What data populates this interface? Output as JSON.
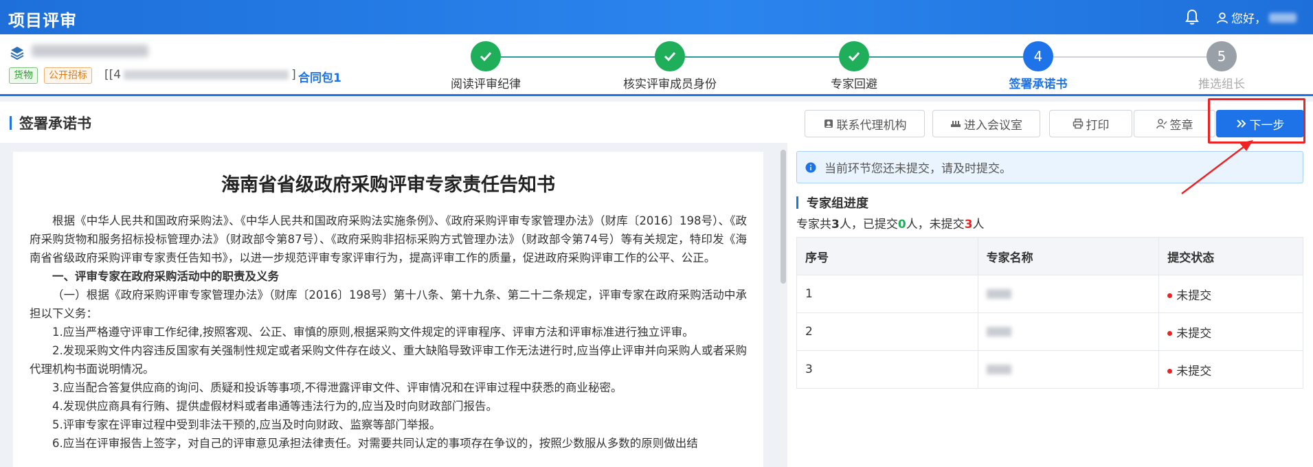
{
  "header": {
    "title": "项目评审",
    "greeting": "您好，"
  },
  "project": {
    "tags": [
      "货物",
      "公开招标"
    ],
    "code_prefix": "[[4",
    "code_suffix": "]",
    "package": "合同包1"
  },
  "steps": [
    {
      "label": "阅读评审纪律",
      "state": "done"
    },
    {
      "label": "核实评审成员身份",
      "state": "done"
    },
    {
      "label": "专家回避",
      "state": "done"
    },
    {
      "label": "签署承诺书",
      "state": "current",
      "number": "4"
    },
    {
      "label": "推选组长",
      "state": "todo",
      "number": "5"
    }
  ],
  "section": {
    "title": "签署承诺书",
    "buttons": {
      "contact": "联系代理机构",
      "meeting": "进入会议室",
      "print": "打印",
      "sign": "签章",
      "next": "下一步"
    }
  },
  "document": {
    "title": "海南省省级政府采购评审专家责任告知书",
    "paragraphs": [
      "根据《中华人民共和国政府采购法》、《中华人民共和国政府采购法实施条例》、《政府采购评审专家管理办法》（财库〔2016〕198号）、《政府采购货物和服务招标投标管理办法》（财政部令第87号）、《政府采购非招标采购方式管理办法》（财政部令第74号）等有关规定，特印发《海南省省级政府采购评审专家责任告知书》，以进一步规范评审专家评审行为，提高评审工作的质量，促进政府采购评审工作的公平、公正。",
      "一、评审专家在政府采购活动中的职责及义务",
      "（一）根据《政府采购评审专家管理办法》（财库〔2016〕198号）第十八条、第十九条、第二十二条规定，评审专家在政府采购活动中承担以下义务：",
      "1.应当严格遵守评审工作纪律,按照客观、公正、审慎的原则,根据采购文件规定的评审程序、评审方法和评审标准进行独立评审。",
      "2.发现采购文件内容违反国家有关强制性规定或者采购文件存在歧义、重大缺陷导致评审工作无法进行时,应当停止评审并向采购人或者采购代理机构书面说明情况。",
      "3.应当配合答复供应商的询问、质疑和投诉等事项,不得泄露评审文件、评审情况和在评审过程中获悉的商业秘密。",
      "4.发现供应商具有行贿、提供虚假材料或者串通等违法行为的,应当及时向财政部门报告。",
      "5.评审专家在评审过程中受到非法干预的,应当及时向财政、监察等部门举报。",
      "6.应当在评审报告上签字，对自己的评审意见承担法律责任。对需要共同认定的事项存在争议的，按照少数服从多数的原则做出结"
    ]
  },
  "notice": "当前环节您还未提交，请及时提交。",
  "progress": {
    "title": "专家组进度",
    "summary_prefix": "专家共",
    "total": "3",
    "summary_mid1": "人，已提交",
    "submitted": "0",
    "summary_mid2": "人，未提交",
    "pending": "3",
    "summary_suffix": "人",
    "columns": [
      "序号",
      "专家名称",
      "提交状态"
    ],
    "rows": [
      {
        "index": "1",
        "status": "未提交"
      },
      {
        "index": "2",
        "status": "未提交"
      },
      {
        "index": "3",
        "status": "未提交"
      }
    ]
  }
}
